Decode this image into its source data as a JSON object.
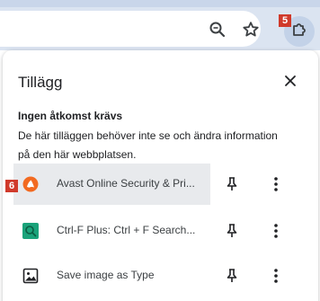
{
  "toolbar": {
    "zoom_icon": "zoom-out-icon",
    "star_icon": "bookmark-star-icon",
    "extensions_icon": "puzzle-icon"
  },
  "markers": {
    "m5": "5",
    "m6": "6"
  },
  "panel": {
    "title": "Tillägg",
    "section_title": "Ingen åtkomst krävs",
    "section_desc": "De här tilläggen behöver inte se och ändra information på den här webbplatsen.",
    "extensions": [
      {
        "name": "Avast Online Security & Pri...",
        "icon": "avast-icon",
        "pinned": false,
        "highlighted": true
      },
      {
        "name": "Ctrl-F Plus: Ctrl + F Search...",
        "icon": "ctrlf-search-icon",
        "pinned": false,
        "highlighted": false
      },
      {
        "name": "Save image as Type",
        "icon": "image-icon",
        "pinned": false,
        "highlighted": false
      }
    ]
  },
  "colors": {
    "chrome_bg": "#dbe4f1",
    "marker_red": "#d03a2b",
    "avast_orange": "#f26a21",
    "ctrlf_green": "#1aa37a",
    "highlight_bg": "#e8eaed"
  }
}
